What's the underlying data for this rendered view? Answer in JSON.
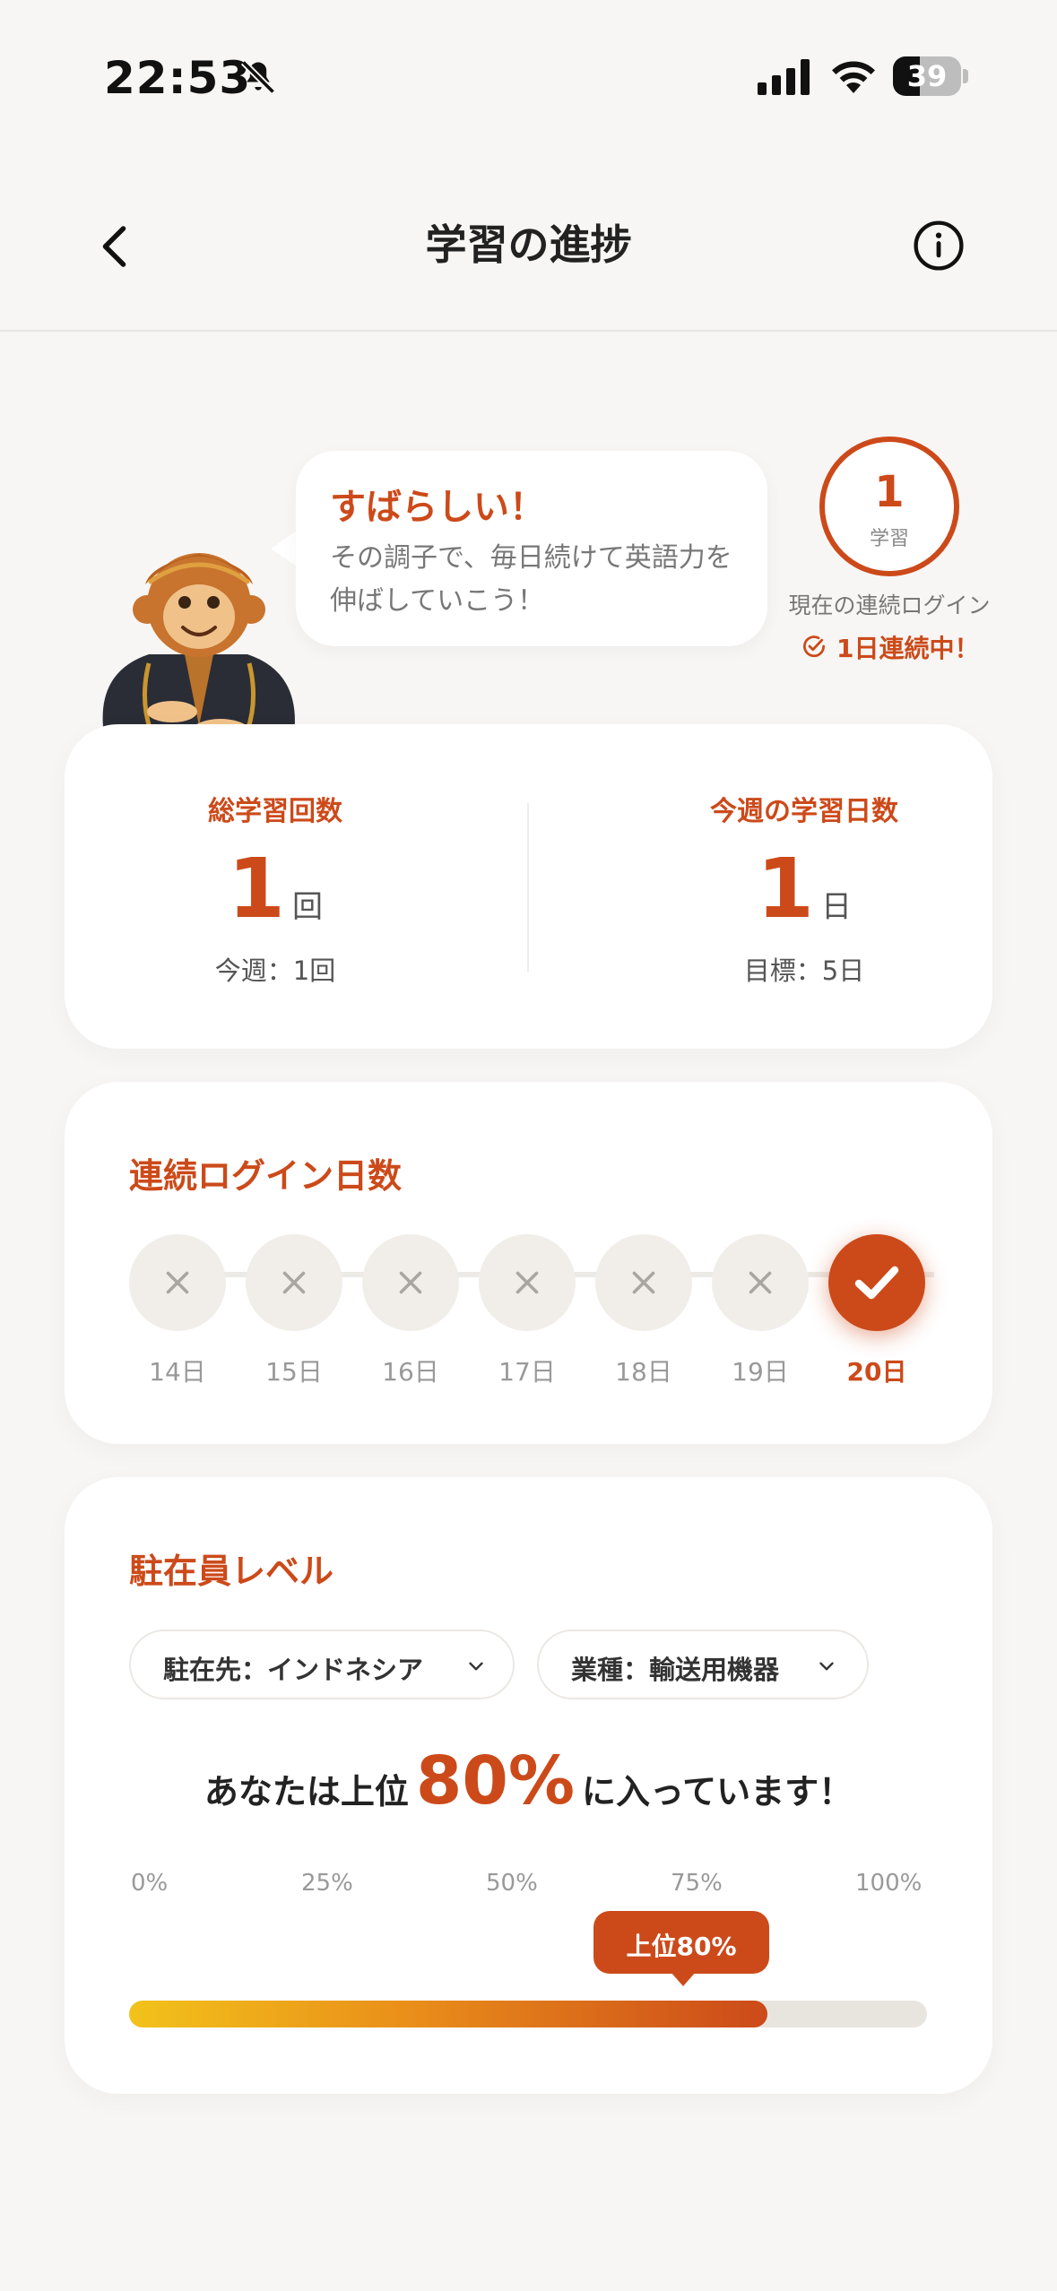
{
  "status_bar": {
    "time": "22:53",
    "battery_level": "39",
    "battery_fraction": 0.39
  },
  "nav": {
    "title": "学習の進捗"
  },
  "hero": {
    "bubble_title": "すばらしい！",
    "bubble_text": "その調子で、毎日続けて英語力を伸ばしていこう！",
    "streak_count": "1",
    "streak_unit": "学習",
    "streak_caption": "現在の連続ログイン",
    "streak_status": "1日連続中！"
  },
  "stats": {
    "total_label": "総学習回数",
    "total_value": "1",
    "total_unit": "回",
    "total_sub": "今週：1回",
    "week_label": "今週の学習日数",
    "week_value": "1",
    "week_unit": "日",
    "week_sub": "目標：5日"
  },
  "login_days": {
    "title": "連続ログイン日数",
    "days": [
      {
        "label": "14日",
        "done": false
      },
      {
        "label": "15日",
        "done": false
      },
      {
        "label": "16日",
        "done": false
      },
      {
        "label": "17日",
        "done": false
      },
      {
        "label": "18日",
        "done": false
      },
      {
        "label": "19日",
        "done": false
      },
      {
        "label": "20日",
        "done": true
      }
    ]
  },
  "level": {
    "title": "駐在員レベル",
    "location_select": "駐在先：インドネシア",
    "industry_select": "業種：輸送用機器",
    "rank_prefix": "あなたは上位",
    "rank_value": "80%",
    "rank_suffix": "に入っています！",
    "scale_labels": [
      "0%",
      "25%",
      "50%",
      "75%",
      "100%"
    ],
    "tooltip": "上位80%",
    "progress_fraction": 0.8
  },
  "colors": {
    "accent": "#cc4a1a",
    "background": "#f7f6f4",
    "card": "#ffffff"
  }
}
